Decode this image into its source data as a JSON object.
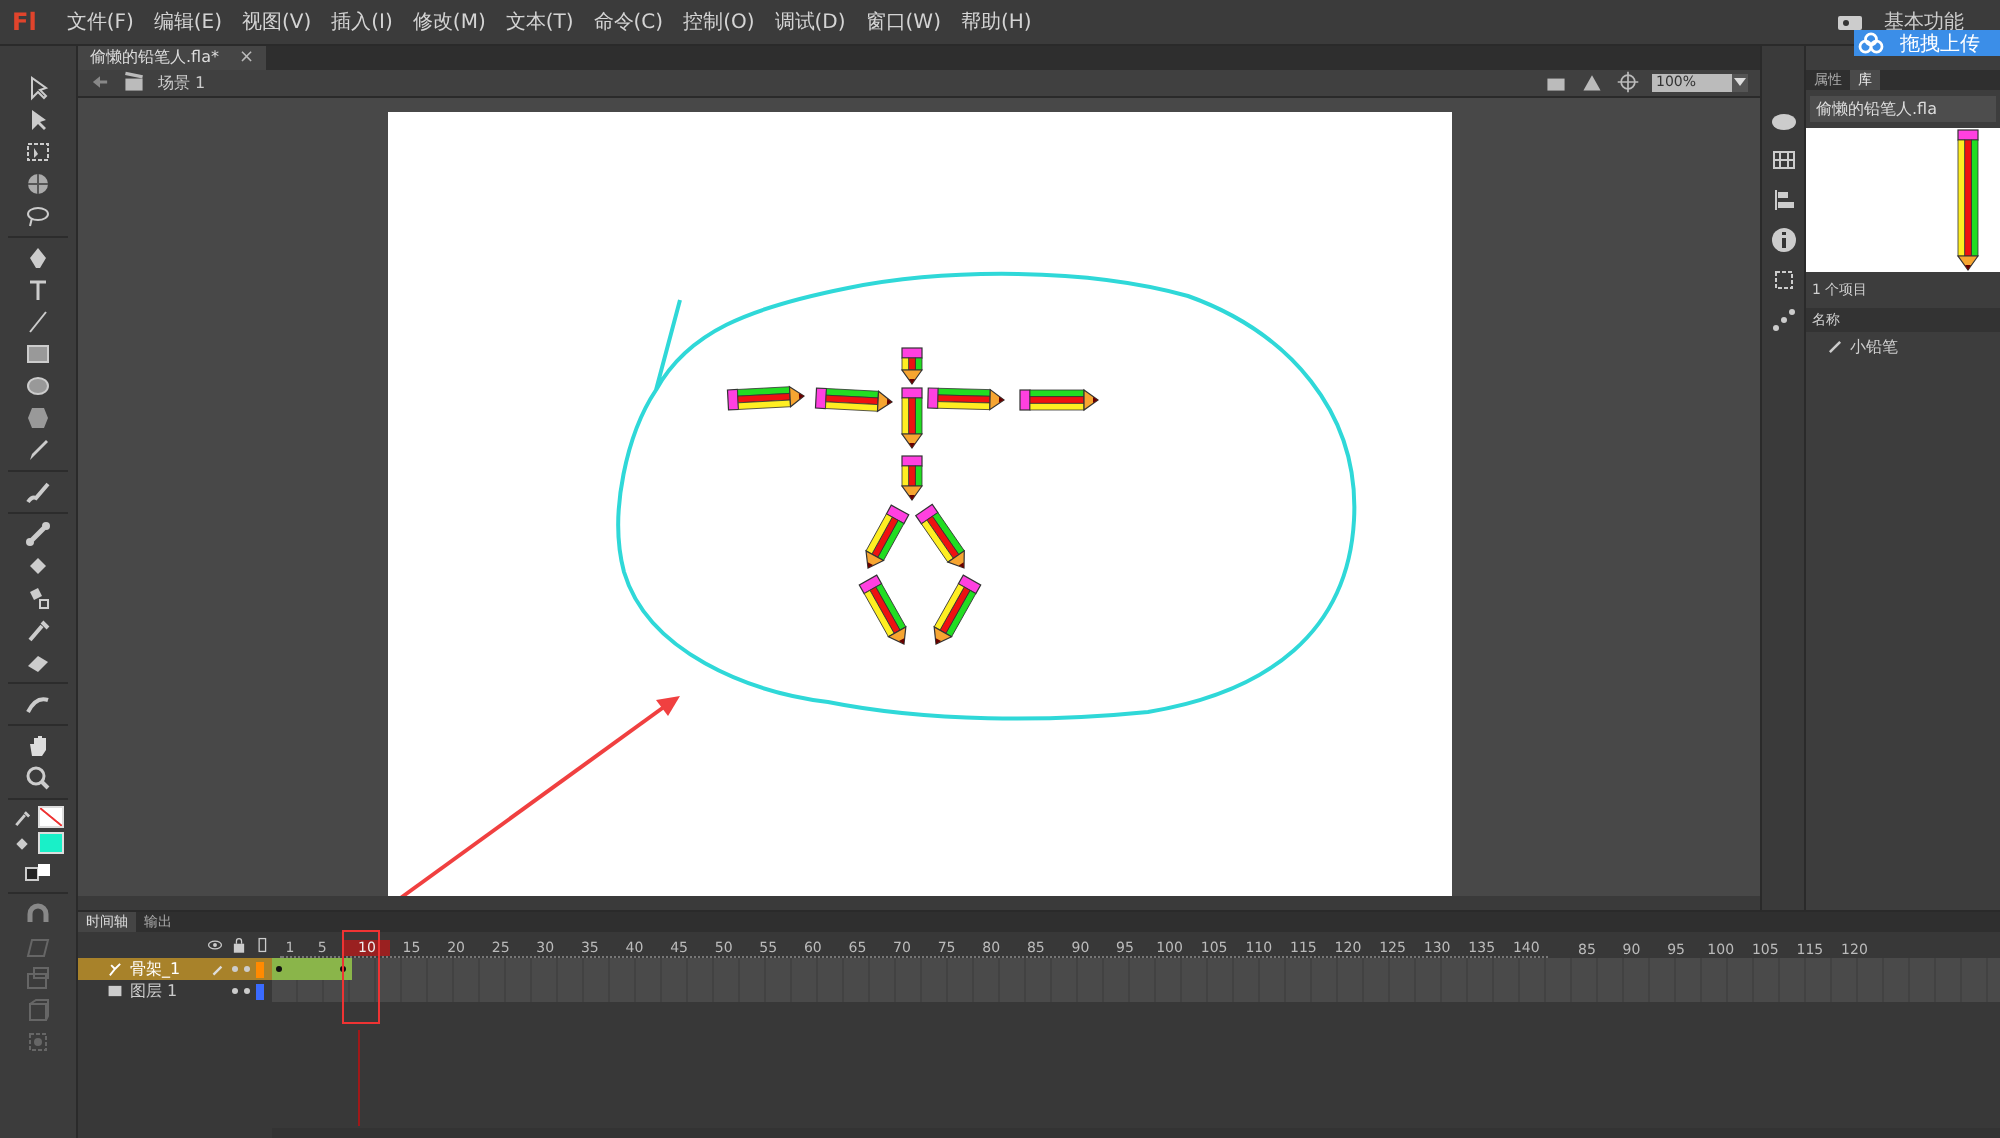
{
  "app": {
    "logo": "Fl",
    "menu": [
      "文件(F)",
      "编辑(E)",
      "视图(V)",
      "插入(I)",
      "修改(M)",
      "文本(T)",
      "命令(C)",
      "控制(O)",
      "调试(D)",
      "窗口(W)",
      "帮助(H)"
    ],
    "workspace": "基本功能",
    "upload_button": "拖拽上传"
  },
  "document_tab": {
    "title": "偷懒的铅笔人.fla*",
    "close": "×"
  },
  "scene_bar": {
    "scene": "场景 1",
    "zoom": "100%"
  },
  "library": {
    "tabs": [
      {
        "label": "属性",
        "selected": false
      },
      {
        "label": "库",
        "selected": true
      }
    ],
    "document": "偷懒的铅笔人.fla",
    "item_count": "1 个项目",
    "column": "名称",
    "items": [
      {
        "name": "小铅笔"
      }
    ]
  },
  "timeline": {
    "tabs": [
      {
        "label": "时间轴",
        "selected": true
      },
      {
        "label": "输出",
        "selected": false
      }
    ],
    "ruler": [
      {
        "label": "1",
        "selected": false
      },
      {
        "label": "5",
        "selected": false
      },
      {
        "label": "10",
        "selected": true
      },
      {
        "label": "15",
        "selected": false
      },
      {
        "label": "20",
        "selected": false
      },
      {
        "label": "25",
        "selected": false
      },
      {
        "label": "30",
        "selected": false
      },
      {
        "label": "35",
        "selected": false
      },
      {
        "label": "40",
        "selected": false
      },
      {
        "label": "45",
        "selected": false
      },
      {
        "label": "50",
        "selected": false
      },
      {
        "label": "55",
        "selected": false
      },
      {
        "label": "60",
        "selected": false
      },
      {
        "label": "65",
        "selected": false
      },
      {
        "label": "70",
        "selected": false
      },
      {
        "label": "75",
        "selected": false
      },
      {
        "label": "80",
        "selected": false
      },
      {
        "label": "85",
        "selected": false
      },
      {
        "label": "90",
        "selected": false
      },
      {
        "label": "95",
        "selected": false
      },
      {
        "label": "100",
        "selected": false
      },
      {
        "label": "105",
        "selected": false
      },
      {
        "label": "110",
        "selected": false
      },
      {
        "label": "115",
        "selected": false
      },
      {
        "label": "120",
        "selected": false
      },
      {
        "label": "125",
        "selected": false
      },
      {
        "label": "130",
        "selected": false
      },
      {
        "label": "135",
        "selected": false
      },
      {
        "label": "140",
        "selected": false
      }
    ],
    "ruler_overflow": [
      "85",
      "90",
      "95",
      "100",
      "105",
      "115",
      "120"
    ],
    "layers": [
      {
        "name": "骨架_1",
        "kind": "armature",
        "selected": true,
        "color": "#ff8a00"
      },
      {
        "name": "图层 1",
        "kind": "normal",
        "selected": false,
        "color": "#3a6bff"
      }
    ]
  }
}
